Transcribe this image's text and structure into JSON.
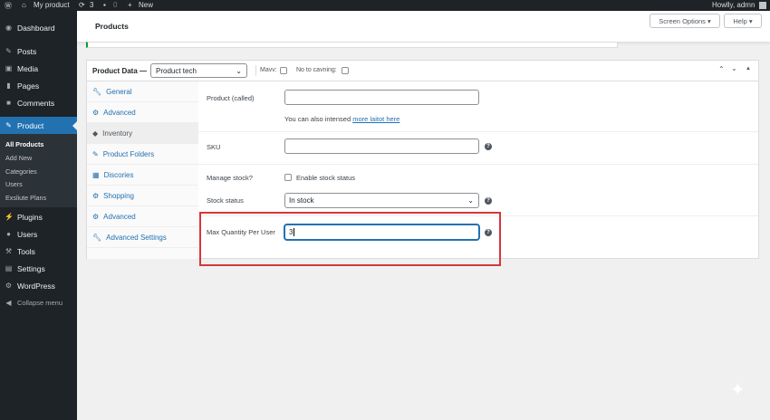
{
  "adminbar": {
    "site": "My product",
    "updates": "3",
    "comments": "0",
    "new": "New",
    "greeting": "Howlly, admn"
  },
  "sidebar": {
    "items": [
      "Dashboard",
      "Posts",
      "Media",
      "Pages",
      "Comments",
      "Product",
      "Plugins",
      "Users",
      "Tools",
      "Settings",
      "WordPress",
      "Collapse menu"
    ],
    "submenu": [
      "All Products",
      "Add New",
      "Categories",
      "Users",
      "Exsliute Plans"
    ]
  },
  "header": {
    "title": "Products",
    "screen_options": "Screen Options ▾",
    "help": "Help ▾"
  },
  "panel": {
    "title": "Product Data —",
    "type": "Product tech",
    "opt1": "Mavv:",
    "opt2": "No to cavning:",
    "tabs": [
      "General",
      "Advanced",
      "Inventory",
      "Product Folders",
      "Discories",
      "Shopping",
      "Advanced",
      "Advanced Settings"
    ],
    "fields": {
      "product_called": "Product (called)",
      "helper": "You can also intensed",
      "helper_link": "more laitot here",
      "sku": "SKU",
      "manage_stock": "Manage stock?",
      "enable_stock": "Enable stock status",
      "stock_status": "Stock status",
      "stock_value": "In stock",
      "max_qty": "Max Quantity Per User",
      "max_qty_value": "3"
    }
  },
  "colors": {
    "accent": "#2271b1",
    "highlight": "#d63638"
  }
}
